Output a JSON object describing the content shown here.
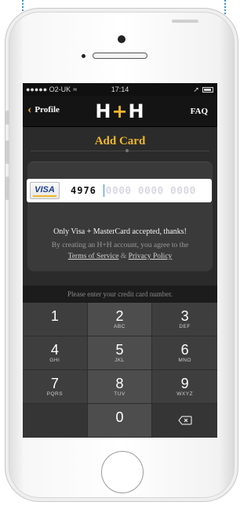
{
  "statusbar": {
    "carrier": "●●●●● O2-UK",
    "wifi": "≈",
    "time": "17:14",
    "location": "➚"
  },
  "navbar": {
    "back_label": "Profile",
    "logo_left": "H",
    "logo_plus": "+",
    "logo_right": "H",
    "faq_label": "FAQ"
  },
  "page": {
    "title": "Add Card"
  },
  "card": {
    "brand_label": "VISA",
    "entered_digits": "4976",
    "placeholder": "0000 0000 0000"
  },
  "notice": {
    "accepted": "Only Visa + MasterCard accepted, thanks!",
    "agree_prefix": "By creating an H+H account, you agree to the",
    "terms_label": "Terms of Service",
    "ampersand": "&",
    "privacy_label": "Privacy Policy"
  },
  "hint": "Please enter your credit card number.",
  "keypad": [
    {
      "num": "1",
      "letters": ""
    },
    {
      "num": "2",
      "letters": "ABC"
    },
    {
      "num": "3",
      "letters": "DEF"
    },
    {
      "num": "4",
      "letters": "GHI"
    },
    {
      "num": "5",
      "letters": "JKL"
    },
    {
      "num": "6",
      "letters": "MNO"
    },
    {
      "num": "7",
      "letters": "PQRS"
    },
    {
      "num": "8",
      "letters": "TUV"
    },
    {
      "num": "9",
      "letters": "WXYZ"
    },
    {
      "num": "",
      "letters": ""
    },
    {
      "num": "0",
      "letters": ""
    },
    {
      "num": "",
      "letters": ""
    }
  ],
  "colors": {
    "accent": "#f0b72a",
    "screen_bg": "#2b2b2b",
    "frame_outline": "#3b97c9"
  }
}
